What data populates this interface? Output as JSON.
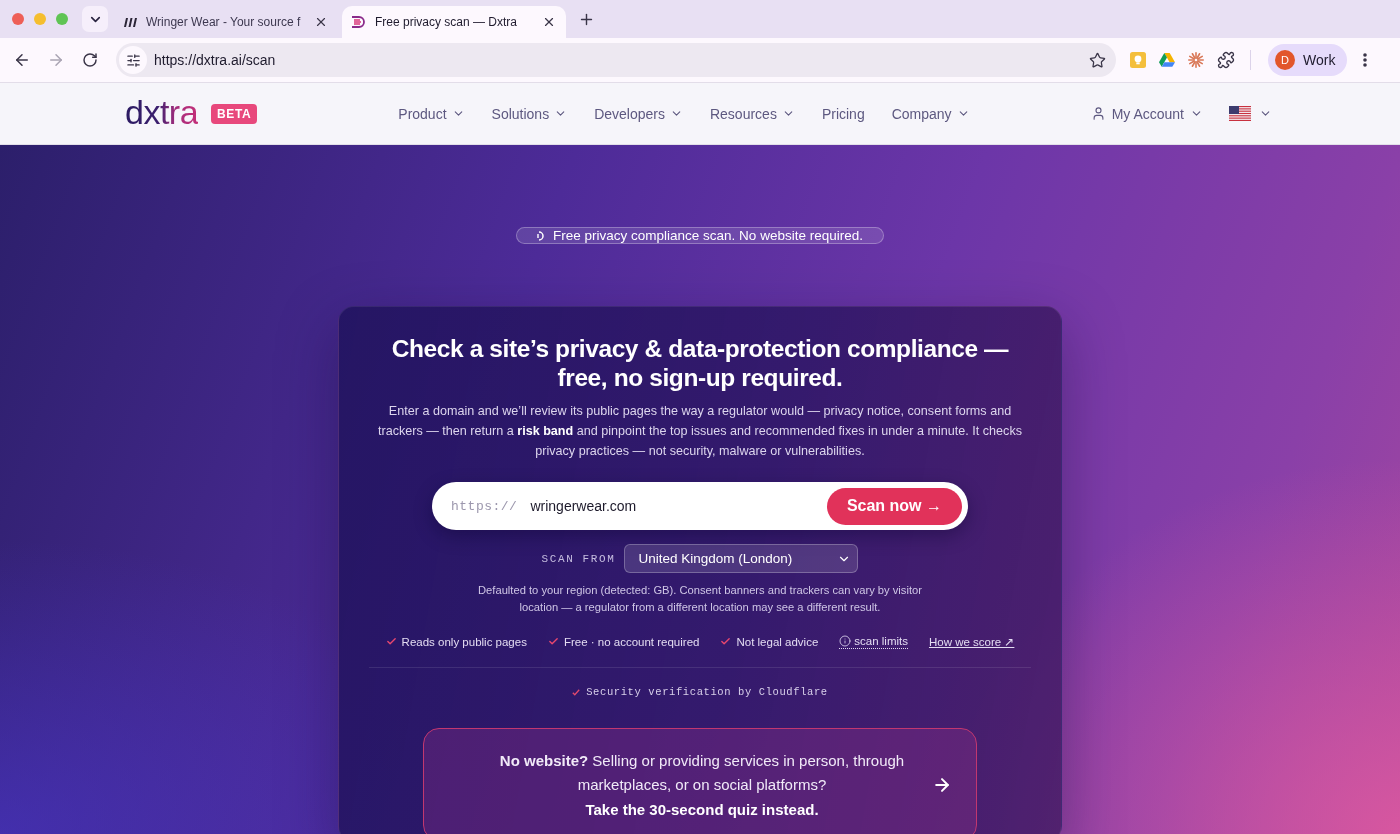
{
  "browser": {
    "tabs": [
      {
        "title": "Wringer Wear - Your source f",
        "kind": "stripes",
        "selected": false
      },
      {
        "title": "Free privacy scan — Dxtra",
        "kind": "monogram",
        "selected": true
      }
    ],
    "forward_disabled": true,
    "address": "https://dxtra.ai/scan",
    "profile": {
      "initial": "D",
      "label": "Work"
    }
  },
  "site_header": {
    "logo": "dxtra",
    "badge": "BETA",
    "nav": [
      {
        "label": "Product",
        "kind": "menu"
      },
      {
        "label": "Solutions",
        "kind": "menu"
      },
      {
        "label": "Developers",
        "kind": "menu"
      },
      {
        "label": "Resources",
        "kind": "menu"
      },
      {
        "label": "Pricing",
        "kind": "link"
      },
      {
        "label": "Company",
        "kind": "menu"
      }
    ],
    "account": "My Account"
  },
  "hero": {
    "badge": "Free privacy compliance scan. No website required.",
    "title": "Check a site’s privacy & data-protection compliance — free, no sign-up required.",
    "intro": "Enter a domain and we’ll review its public pages the way a regulator would — privacy notice, consent forms and trackers — then return a **risk band** and pinpoint the top issues and recommended fixes in under a minute. It checks privacy practices — not security, malware or vulnerabilities.",
    "scan_field": {
      "prefix": "https://",
      "value": "wringerwear.com"
    },
    "scan_button": "Scan now →",
    "scan_from": {
      "label": "SCAN FROM",
      "value": "United Kingdom (London)"
    },
    "region_note": "Defaulted to your region (detected: GB). Consent banners and trackers can vary by visitor location — a regulator from a different location may see a different result.",
    "assurances": [
      {
        "kind": "check",
        "label": "Reads only public pages"
      },
      {
        "kind": "check",
        "label": "Free · no account required"
      },
      {
        "kind": "check",
        "label": "Not legal advice"
      },
      {
        "kind": "info",
        "label": "scan limits"
      },
      {
        "kind": "link",
        "label": "How we score ↗"
      }
    ],
    "verification": "Security verification by Cloudflare",
    "quiz": {
      "text": "**No website?** Selling or providing services in person, through marketplaces, or on social platforms?",
      "cta": "Take the 30-second quiz instead."
    }
  }
}
